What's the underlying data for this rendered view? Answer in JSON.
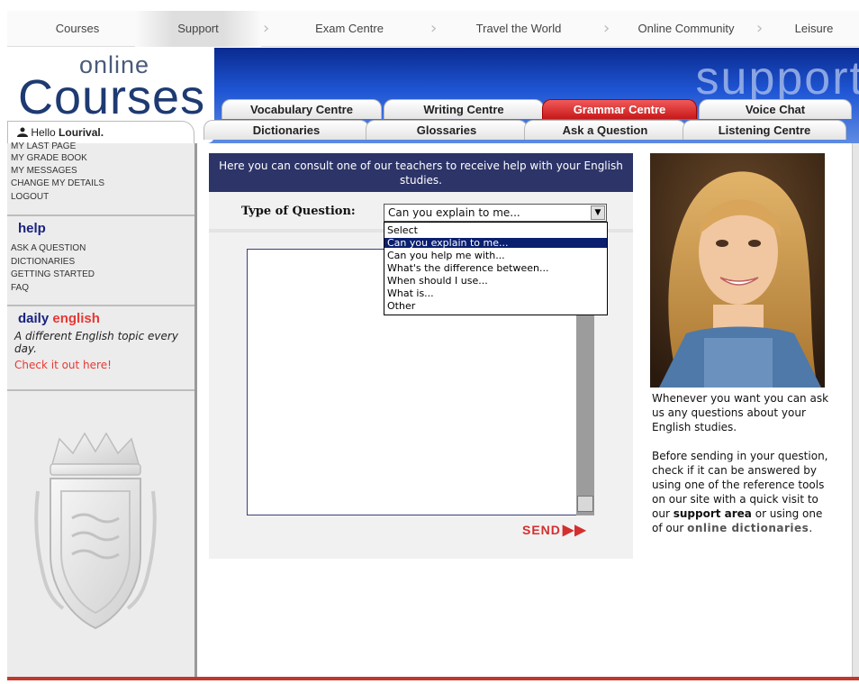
{
  "topnav": {
    "items": [
      "Courses",
      "Support",
      "Exam Centre",
      "Travel the World",
      "Online Community",
      "Leisure"
    ]
  },
  "logo": {
    "online": "online",
    "courses": "Courses",
    "section": "support"
  },
  "tabs": {
    "row1": [
      "Vocabulary Centre",
      "Writing Centre",
      "Grammar Centre",
      "Voice Chat"
    ],
    "row2": [
      "Dictionaries",
      "Glossaries",
      "Ask a Question",
      "Listening Centre"
    ],
    "active": "Grammar Centre"
  },
  "user": {
    "hello": "Hello",
    "name": "Lourival."
  },
  "sidebar": {
    "account_links": [
      "MY LAST PAGE",
      "MY GRADE BOOK",
      "MY MESSAGES",
      "CHANGE MY DETAILS",
      "LOGOUT"
    ],
    "help_heading": "help",
    "help_links": [
      "ASK A QUESTION",
      "DICTIONARIES",
      "GETTING STARTED",
      "FAQ"
    ],
    "daily_heading_1": "daily",
    "daily_heading_2": "english",
    "daily_text": "A different English topic every day.",
    "daily_link": "Check it out here!"
  },
  "main": {
    "intro": "Here you can consult one of our teachers to receive help with your English studies.",
    "question_label": "Type of Question:",
    "selected_option": "Can you explain to me...",
    "options": [
      "Select",
      "Can you explain to me...",
      "Can you help me with...",
      "What's the difference between...",
      "When should I use...",
      "What is...",
      "Other"
    ],
    "send_label": "SEND"
  },
  "right": {
    "text1": "Whenever you want you can ask us any questions about your English studies.",
    "text2_a": "Before sending in your question, check if it can be answered by using one of the reference tools on our site with a quick visit to our ",
    "support_area": "support area",
    "text2_b": " or using one of our ",
    "online_dictionaries": "online dictionaries",
    "text2_c": "."
  },
  "colors": {
    "accent_red": "#e53935",
    "navy": "#2c3468",
    "banner_blue": "#1f55d4"
  }
}
